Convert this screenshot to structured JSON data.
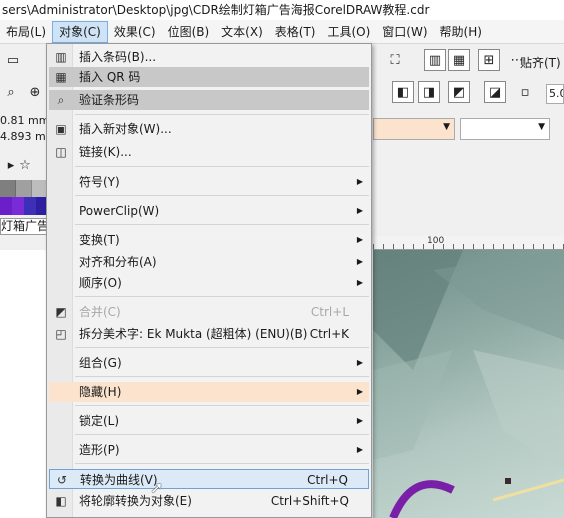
{
  "window": {
    "title": "sers\\Administrator\\Desktop\\jpg\\CDR绘制灯箱广告海报CorelDRAW教程.cdr"
  },
  "menubar": [
    {
      "label": "布局(L)",
      "active": false
    },
    {
      "label": "对象(C)",
      "active": true
    },
    {
      "label": "效果(C)",
      "active": false
    },
    {
      "label": "位图(B)",
      "active": false
    },
    {
      "label": "文本(X)",
      "active": false
    },
    {
      "label": "表格(T)",
      "active": false
    },
    {
      "label": "工具(O)",
      "active": false
    },
    {
      "label": "窗口(W)",
      "active": false
    },
    {
      "label": "帮助(H)",
      "active": false
    }
  ],
  "toolbar": {
    "paste_label": "贴齐(T)",
    "width_value": "0.81 mm",
    "height_value": "4.893 mm",
    "outline_value": "5.0",
    "doc_tab": "灯箱广告海"
  },
  "ruler": {
    "label": "100"
  },
  "colors": {
    "palette_top": [
      "#7f7f7f",
      "#a0a0a0",
      "#bdbdbd",
      "#cfcfcf",
      "#5a5a5a",
      "#7a2bd0",
      "#2d63c8",
      "#3a8ad8",
      "#6fb3e8",
      "#8ed6ea",
      "#78b7a8",
      "#4aa58c",
      "#2f8f64",
      "#1d7a48",
      "#2aa056",
      "#40b86a",
      "#1f8f40",
      "#11783a"
    ],
    "palette_bottom": [
      "#6a1fc8",
      "#7a2bd8",
      "#3d2fb8",
      "#2d1fa0"
    ],
    "menu_peach": "#fbe3cd",
    "menu_selected": "#dce9f6"
  },
  "menu": {
    "items": [
      {
        "label": "插入条码(B)...",
        "shortcut": "",
        "submenu": false,
        "icon": "barcode-icon",
        "state": "normal"
      },
      {
        "label": "插入 QR 码",
        "shortcut": "",
        "submenu": false,
        "icon": "qr-code-icon",
        "state": "highlight"
      },
      {
        "label": "验证条形码",
        "shortcut": "",
        "submenu": false,
        "icon": "validate-barcode-icon",
        "state": "highlight"
      },
      {
        "label": "插入新对象(W)...",
        "shortcut": "",
        "submenu": false,
        "icon": "new-object-icon",
        "state": "normal"
      },
      {
        "label": "链接(K)...",
        "shortcut": "",
        "submenu": false,
        "icon": "ole-link-icon",
        "state": "normal"
      },
      {
        "label": "符号(Y)",
        "shortcut": "",
        "submenu": true,
        "icon": "",
        "state": "normal"
      },
      {
        "label": "PowerClip(W)",
        "shortcut": "",
        "submenu": true,
        "icon": "",
        "state": "normal"
      },
      {
        "label": "变换(T)",
        "shortcut": "",
        "submenu": true,
        "icon": "",
        "state": "normal"
      },
      {
        "label": "对齐和分布(A)",
        "shortcut": "",
        "submenu": true,
        "icon": "",
        "state": "normal"
      },
      {
        "label": "顺序(O)",
        "shortcut": "",
        "submenu": true,
        "icon": "",
        "state": "normal"
      },
      {
        "label": "合并(C)",
        "shortcut": "Ctrl+L",
        "submenu": false,
        "icon": "combine-icon",
        "state": "disabled"
      },
      {
        "label": "拆分美术字: Ek Mukta (超粗体) (ENU)(B)",
        "shortcut": "Ctrl+K",
        "submenu": false,
        "icon": "break-apart-icon",
        "state": "normal"
      },
      {
        "label": "组合(G)",
        "shortcut": "",
        "submenu": true,
        "icon": "",
        "state": "normal"
      },
      {
        "label": "隐藏(H)",
        "shortcut": "",
        "submenu": true,
        "icon": "",
        "state": "peach"
      },
      {
        "label": "锁定(L)",
        "shortcut": "",
        "submenu": true,
        "icon": "",
        "state": "normal"
      },
      {
        "label": "造形(P)",
        "shortcut": "",
        "submenu": true,
        "icon": "",
        "state": "normal"
      },
      {
        "label": "转换为曲线(V)",
        "shortcut": "Ctrl+Q",
        "submenu": false,
        "icon": "convert-to-curves-icon",
        "state": "selected"
      },
      {
        "label": "将轮廓转换为对象(E)",
        "shortcut": "Ctrl+Shift+Q",
        "submenu": false,
        "icon": "outline-to-object-icon",
        "state": "normal"
      }
    ]
  }
}
